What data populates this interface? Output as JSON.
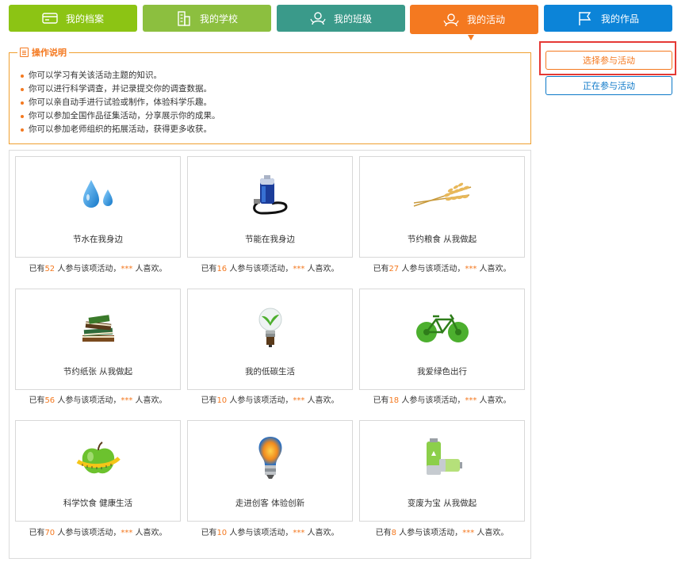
{
  "tabs": [
    {
      "label": "我的档案",
      "icon": "profile-card-icon",
      "color": "#8cc414"
    },
    {
      "label": "我的学校",
      "icon": "school-building-icon",
      "color": "#8cbf3f"
    },
    {
      "label": "我的班级",
      "icon": "class-group-icon",
      "color": "#3a9a8a"
    },
    {
      "label": "我的活动",
      "icon": "activity-hand-icon",
      "color": "#f47920",
      "active": true
    },
    {
      "label": "我的作品",
      "icon": "flag-icon",
      "color": "#0c84d8"
    }
  ],
  "instructions": {
    "title": "操作说明",
    "items": [
      "你可以学习有关该活动主题的知识。",
      "你可以进行科学调查，并记录提交你的调查数据。",
      "你可以亲自动手进行试验或制作，体验科学乐趣。",
      "你可以参加全国作品征集活动，分享展示你的成果。",
      "你可以参加老师组织的拓展活动，获得更多收获。"
    ]
  },
  "side": {
    "select_label": "选择参与活动",
    "current_label": "正在参与活动"
  },
  "activities": [
    {
      "title": "节水在我身边",
      "icon": "water-drops-icon",
      "count_prefix": "已有",
      "count": "52",
      "count_suffix": " 人参与该项活动，",
      "likes": "***",
      "likes_suffix": " 人喜欢。"
    },
    {
      "title": "节能在我身边",
      "icon": "battery-plug-icon",
      "count_prefix": "已有",
      "count": "16",
      "count_suffix": " 人参与该项活动，",
      "likes": "***",
      "likes_suffix": " 人喜欢。"
    },
    {
      "title": "节约粮食 从我做起",
      "icon": "wheat-icon",
      "count_prefix": "已有",
      "count": "27",
      "count_suffix": " 人参与该项活动，",
      "likes": "***",
      "likes_suffix": " 人喜欢。"
    },
    {
      "title": "节约纸张 从我做起",
      "icon": "books-icon",
      "count_prefix": "已有",
      "count": "56",
      "count_suffix": " 人参与该项活动，",
      "likes": "***",
      "likes_suffix": " 人喜欢。"
    },
    {
      "title": "我的低碳生活",
      "icon": "eco-bulb-icon",
      "count_prefix": "已有",
      "count": "10",
      "count_suffix": " 人参与该项活动，",
      "likes": "***",
      "likes_suffix": " 人喜欢。"
    },
    {
      "title": "我爱绿色出行",
      "icon": "green-bicycle-icon",
      "count_prefix": "已有",
      "count": "18",
      "count_suffix": " 人参与该项活动，",
      "likes": "***",
      "likes_suffix": " 人喜欢。"
    },
    {
      "title": "科学饮食 健康生活",
      "icon": "apple-tape-icon",
      "count_prefix": "已有",
      "count": "70",
      "count_suffix": " 人参与该项活动，",
      "likes": "***",
      "likes_suffix": " 人喜欢。"
    },
    {
      "title": "走进创客 体验创新",
      "icon": "light-bulb-icon",
      "count_prefix": "已有",
      "count": "10",
      "count_suffix": " 人参与该项活动，",
      "likes": "***",
      "likes_suffix": " 人喜欢。"
    },
    {
      "title": "变废为宝 从我做起",
      "icon": "recycle-battery-icon",
      "count_prefix": "已有",
      "count": "8",
      "count_suffix": " 人参与该项活动，",
      "likes": "***",
      "likes_suffix": " 人喜欢。"
    }
  ]
}
